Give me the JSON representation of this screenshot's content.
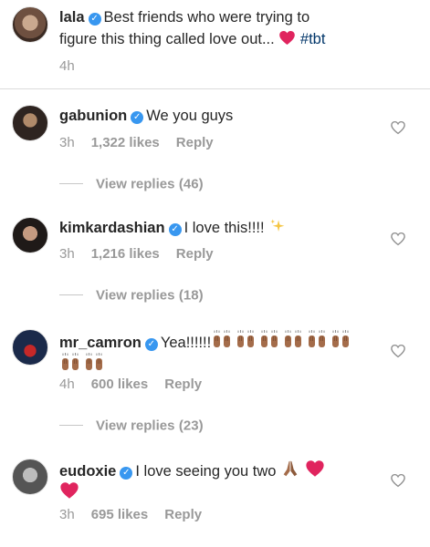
{
  "post": {
    "username": "lala",
    "caption_line1": "Best friends who were trying to",
    "caption_line2": "figure this thing called love out...",
    "hashtag": "#tbt",
    "time": "4h"
  },
  "view_replies_prefix": "View replies",
  "comments": [
    {
      "username": "gabunion",
      "text": "We you guys",
      "time": "3h",
      "likes": "1,322 likes",
      "reply": "Reply",
      "replies": "(46)"
    },
    {
      "username": "kimkardashian",
      "text": "I love this!!!!",
      "time": "3h",
      "likes": "1,216 likes",
      "reply": "Reply",
      "replies": "(18)"
    },
    {
      "username": "mr_camron",
      "text": "Yea!!!!!!",
      "time": "4h",
      "likes": "600 likes",
      "reply": "Reply",
      "replies": "(23)"
    },
    {
      "username": "eudoxie",
      "text": "I love seeing you two",
      "time": "3h",
      "likes": "695 likes",
      "reply": "Reply"
    }
  ],
  "icons": {
    "verified": "verified-badge-icon",
    "like": "heart-outline-icon",
    "red_heart": "red-heart-emoji",
    "sparkles": "sparkles-emoji",
    "raising_hands": "raising-hands-emoji",
    "folded_hands": "folded-hands-emoji"
  },
  "colors": {
    "verified_blue": "#3897f0",
    "hashtag": "#003569",
    "meta_gray": "#999999",
    "heart_red": "#e0245e"
  }
}
